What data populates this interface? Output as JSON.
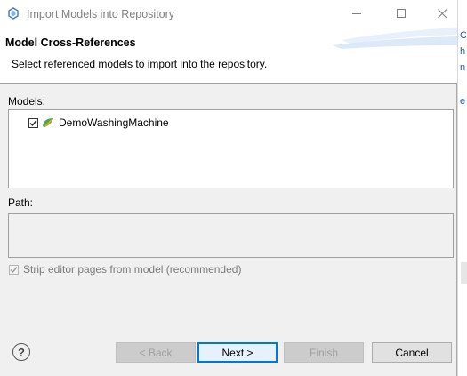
{
  "window": {
    "title": "Import Models into Repository"
  },
  "header": {
    "title": "Model Cross-References",
    "description": "Select referenced models to import into the repository."
  },
  "models": {
    "label": "Models:",
    "items": [
      {
        "name": "DemoWashingMachine",
        "checked": true
      }
    ]
  },
  "path": {
    "label": "Path:",
    "value": ""
  },
  "options": {
    "strip_label": "Strip editor pages from model (recommended)",
    "strip_checked": true,
    "strip_enabled": false
  },
  "buttons": {
    "back": "< Back",
    "next": "Next >",
    "finish": "Finish",
    "cancel": "Cancel",
    "help": "?"
  },
  "colors": {
    "accent": "#0078d7",
    "dialog_bg": "#f0f0f0",
    "disabled_text": "#a0a0a0",
    "header_deco": "#dce9f8"
  },
  "icons": {
    "app": "eclipse-app-icon",
    "model": "model-leaf-icon",
    "check": "checkmark-icon",
    "help": "help-icon"
  }
}
